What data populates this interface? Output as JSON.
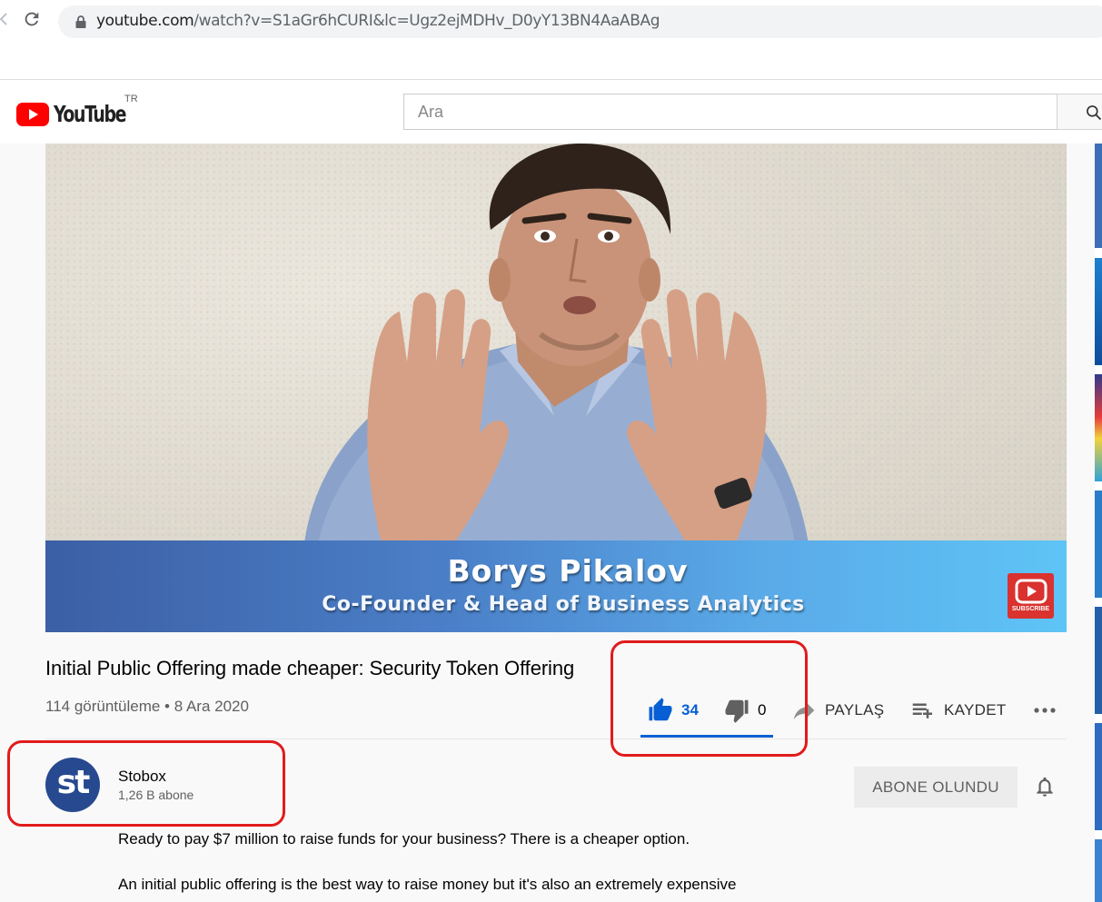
{
  "browser": {
    "url_host": "youtube.com",
    "url_rest": "/watch?v=S1aGr6hCURI&lc=Ugz2ejMDHv_D0yY13BN4AaABAg"
  },
  "header": {
    "logo_text": "YouTube",
    "country": "TR",
    "search_placeholder": "Ara"
  },
  "video": {
    "lower_third_name": "Borys Pikalov",
    "lower_third_role": "Co-Founder & Head of Business Analytics",
    "subscribe_badge": "SUBSCRIBE",
    "title": "Initial Public Offering made cheaper: Security Token Offering",
    "meta": "114 görüntüleme • 8 Ara 2020"
  },
  "actions": {
    "likes": "34",
    "dislikes": "0",
    "share_label": "PAYLAŞ",
    "save_label": "KAYDET"
  },
  "channel": {
    "avatar_text": "st",
    "name": "Stobox",
    "subscribers": "1,26 B abone",
    "subscribed_label": "ABONE OLUNDU"
  },
  "description": {
    "line1": "Ready to pay $7 million to raise funds for your business? There is a cheaper option.",
    "line2": "An initial public offering is the best way to raise money but it's also an extremely expensive"
  },
  "colors": {
    "accent_blue": "#065fd4",
    "annotation_red": "#e21b1b",
    "youtube_red": "#ff0000",
    "avatar_blue": "#27498f"
  }
}
